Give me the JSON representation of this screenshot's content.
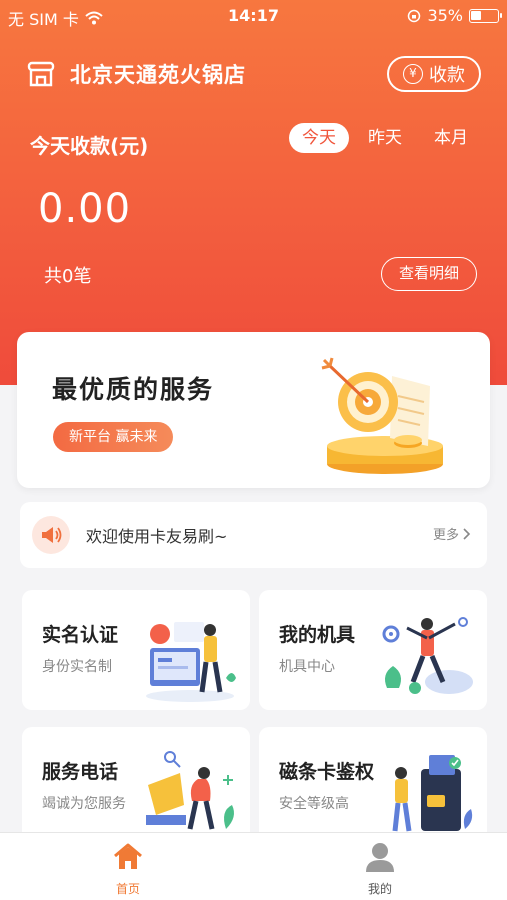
{
  "status_bar": {
    "carrier": "无 SIM 卡",
    "time": "14:17",
    "battery": "35%",
    "battery_level": 0.35
  },
  "header": {
    "store_name": "北京天通苑火锅店",
    "collect_label": "收款",
    "yen_symbol": "¥",
    "today_label": "今天收款(元)",
    "tabs": [
      {
        "label": "今天",
        "active": true
      },
      {
        "label": "昨天"
      },
      {
        "label": "本月"
      }
    ],
    "amount": "0.00",
    "count": "共0笔",
    "detail_label": "查看明细"
  },
  "banner": {
    "title": "最优质的服务",
    "tag": "新平台 赢未来"
  },
  "notice": {
    "text": "欢迎使用卡友易刷~",
    "more_label": "更多"
  },
  "cards": [
    {
      "title": "实名认证",
      "subtitle": "身份实名制"
    },
    {
      "title": "我的机具",
      "subtitle": "机具中心"
    },
    {
      "title": "服务电话",
      "subtitle": "竭诚为您服务"
    },
    {
      "title": "磁条卡鉴权",
      "subtitle": "安全等级高"
    }
  ],
  "tabbar": [
    {
      "label": "首页",
      "active": true
    },
    {
      "label": "我的",
      "active": false
    }
  ],
  "colors": {
    "accent": "#f35f3e",
    "active_tab": "#f07a35",
    "inactive_tab": "#555555"
  }
}
